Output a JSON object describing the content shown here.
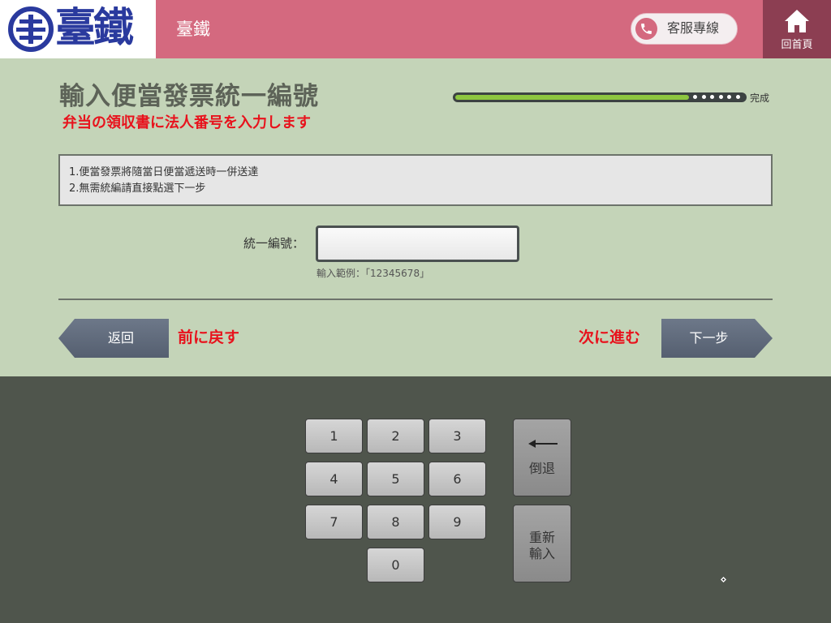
{
  "header": {
    "logo_text": "臺鐵",
    "title": "臺鐵",
    "service_label": "客服專線",
    "home_label": "回首頁"
  },
  "page": {
    "title": "輸入便當發票統一編號",
    "subtitle": "弁当の領収書に法人番号を入力します"
  },
  "progress": {
    "value": 0.81,
    "steps_remaining": 6,
    "label": "完成"
  },
  "notice": {
    "lines": [
      "1.便當發票將隨當日便當遞送時一併送達",
      "2.無需統編請直接點選下一步"
    ]
  },
  "form": {
    "label": "統一編號：",
    "value": "",
    "hint": "輸入範例：「12345678」"
  },
  "nav": {
    "back_label": "返回",
    "back_jp": "前に戻す",
    "next_jp": "次に進む",
    "next_label": "下一步"
  },
  "keypad": {
    "keys": [
      "1",
      "2",
      "3",
      "4",
      "5",
      "6",
      "7",
      "8",
      "9",
      "0"
    ],
    "backspace_label": "倒退",
    "reset_line1": "重新",
    "reset_line2": "輸入"
  },
  "colors": {
    "header_pink": "#d4697f",
    "home_maroon": "#8c3e52",
    "content_green": "#c4d4b8",
    "keypad_bg": "#4f554c",
    "accent_red": "#e8121c",
    "progress_green": "#8dc63f",
    "logo_blue": "#2a3a9e"
  }
}
